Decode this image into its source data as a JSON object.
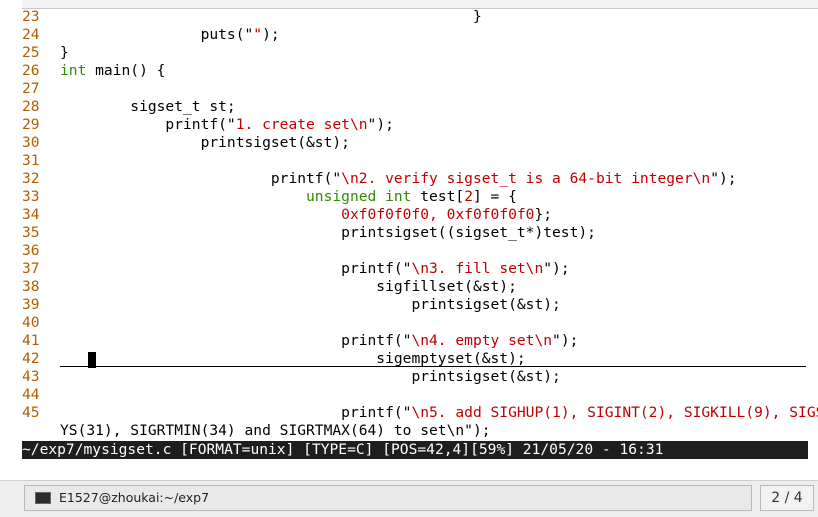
{
  "editor": {
    "continuation": "YS(31), SIGRTMIN(34) and SIGRTMAX(64) to set\\n\");",
    "lines": [
      {
        "n": "23",
        "t": [
          {
            "s": "                                               }"
          }
        ]
      },
      {
        "n": "24",
        "t": [
          {
            "s": "                puts(\""
          },
          {
            "s": "\"",
            "c": "str"
          },
          {
            "s": ");"
          }
        ]
      },
      {
        "n": "25",
        "t": [
          {
            "s": "}"
          }
        ]
      },
      {
        "n": "26",
        "t": [
          {
            "s": "int",
            "c": "kw"
          },
          {
            "s": " main() {"
          }
        ]
      },
      {
        "n": "27",
        "t": []
      },
      {
        "n": "28",
        "t": [
          {
            "s": "        sigset_t st;"
          }
        ]
      },
      {
        "n": "29",
        "t": [
          {
            "s": "            printf(\""
          },
          {
            "s": "1. create set\\n",
            "c": "str"
          },
          {
            "s": "\");"
          }
        ]
      },
      {
        "n": "30",
        "t": [
          {
            "s": "                printsigset(&st);"
          }
        ]
      },
      {
        "n": "31",
        "t": []
      },
      {
        "n": "32",
        "t": [
          {
            "s": "                        printf(\""
          },
          {
            "s": "\\n2. verify sigset_t is a 64-bit integer\\n",
            "c": "str"
          },
          {
            "s": "\");"
          }
        ]
      },
      {
        "n": "33",
        "t": [
          {
            "s": "                            "
          },
          {
            "s": "unsigned",
            "c": "kw"
          },
          {
            "s": " "
          },
          {
            "s": "int",
            "c": "kw"
          },
          {
            "s": " test["
          },
          {
            "s": "2",
            "c": "str"
          },
          {
            "s": "] = {"
          }
        ]
      },
      {
        "n": "34",
        "t": [
          {
            "s": "                                "
          },
          {
            "s": "0xf0f0f0f0, 0xf0f0f0f0",
            "c": "str"
          },
          {
            "s": "};"
          }
        ]
      },
      {
        "n": "35",
        "t": [
          {
            "s": "                                printsigset((sigset_t*)test);"
          }
        ]
      },
      {
        "n": "36",
        "t": []
      },
      {
        "n": "37",
        "t": [
          {
            "s": "                                printf(\""
          },
          {
            "s": "\\n3. fill set\\n",
            "c": "str"
          },
          {
            "s": "\");"
          }
        ]
      },
      {
        "n": "38",
        "t": [
          {
            "s": "                                    sigfillset(&st);"
          }
        ]
      },
      {
        "n": "39",
        "t": [
          {
            "s": "                                        printsigset(&st);"
          }
        ]
      },
      {
        "n": "40",
        "t": []
      },
      {
        "n": "41",
        "t": [
          {
            "s": "                                printf(\""
          },
          {
            "s": "\\n4. empty set\\n",
            "c": "str"
          },
          {
            "s": "\");"
          }
        ]
      },
      {
        "n": "42",
        "t": [
          {
            "s": "                                    sigemptyset(&st);"
          }
        ]
      },
      {
        "n": "43",
        "t": [
          {
            "s": "                                        printsigset(&st);"
          }
        ]
      },
      {
        "n": "44",
        "t": []
      },
      {
        "n": "45",
        "t": [
          {
            "s": "                                printf(\""
          },
          {
            "s": "\\n5. add SIGHUP(1), SIGINT(2), SIGKILL(9), SIGS",
            "c": "str"
          }
        ]
      }
    ]
  },
  "status": {
    "text": "~/exp7/mysigset.c [FORMAT=unix] [TYPE=C] [POS=42,4][59%] 21/05/20 - 16:31"
  },
  "taskbar": {
    "window_label": "E1527@zhoukai:~/exp7",
    "workspace": "2 / 4"
  },
  "colors": {
    "line_number": "#b06000",
    "string": "#c00000",
    "keyword": "#2e8b00",
    "status_bg": "#1e1e1e"
  },
  "icons": [
    "terminal-icon"
  ]
}
